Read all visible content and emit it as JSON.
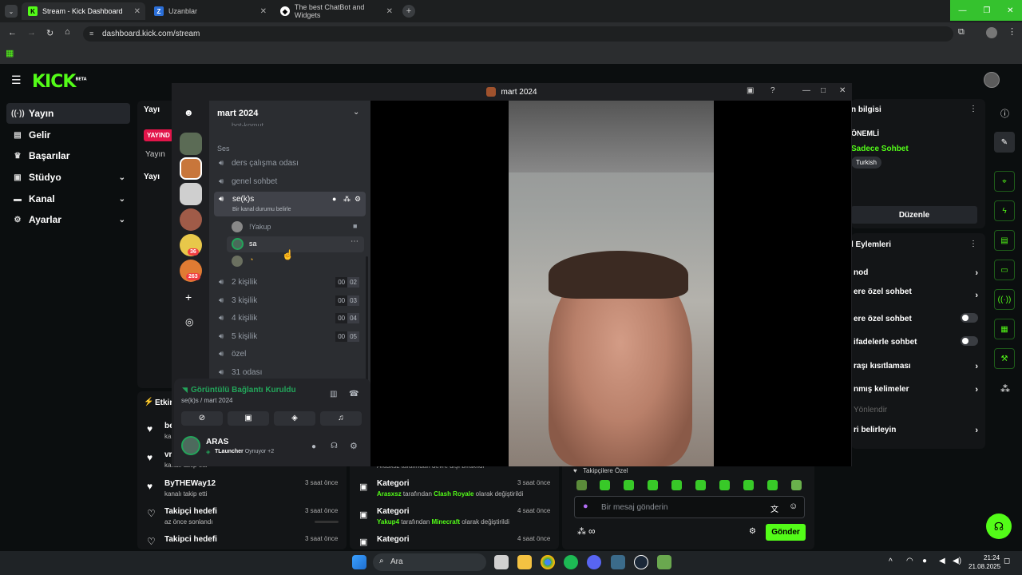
{
  "browser": {
    "tabs": [
      {
        "label": "Stream - Kick Dashboard",
        "icon": "kick-icon"
      },
      {
        "label": "Uzanblar",
        "icon": "globe-icon"
      },
      {
        "label": "The best ChatBot and Widgets",
        "icon": "bot-icon"
      }
    ],
    "url": "dashboard.kick.com/stream"
  },
  "kick": {
    "logo": "KICK",
    "beta": "BETA",
    "nav": [
      {
        "label": "Yayın",
        "icon": "broadcast-icon"
      },
      {
        "label": "Gelir",
        "icon": "income-icon"
      },
      {
        "label": "Başarılar",
        "icon": "trophy-icon"
      },
      {
        "label": "Stüdyo",
        "icon": "studio-icon"
      },
      {
        "label": "Kanal",
        "icon": "channel-icon"
      },
      {
        "label": "Ayarlar",
        "icon": "settings-icon"
      }
    ],
    "stream_panel": {
      "title": "Yayı",
      "live_badge": "YAYIND",
      "sub": "Yayın",
      "title2": "Yayı"
    },
    "activity": {
      "title": "Etkin",
      "rows": [
        {
          "name": "be",
          "desc": "kan",
          "time": ""
        },
        {
          "name": "vr",
          "desc": "kanalı takip etti",
          "time": ""
        },
        {
          "name": "ByTHEWay12",
          "desc": "kanalı takip etti",
          "time": "3 saat önce"
        },
        {
          "name": "Takipçi hedefi",
          "desc": "az önce sonlandı",
          "time": "3 saat önce"
        },
        {
          "name": "Takipci hedefi",
          "desc": "",
          "time": "3 saat önce"
        }
      ]
    },
    "category_feed": {
      "partial": "Arasxsz tarafından devre dışı bırakıldı",
      "rows": [
        {
          "title": "Kategori",
          "user": "Arasxsz",
          "mid": " tarafından ",
          "game": "Clash Royale",
          "end": " olarak değiştirildi",
          "time": "3 saat önce"
        },
        {
          "title": "Kategori",
          "user": "Yakup4",
          "mid": " tarafından ",
          "game": "Minecraft",
          "end": " olarak değiştirildi",
          "time": "4 saat önce"
        },
        {
          "title": "Kategori",
          "user": "",
          "mid": "",
          "game": "",
          "end": "",
          "time": "4 saat önce"
        }
      ]
    },
    "chat": {
      "followers_only": "Takipçilere Özel",
      "placeholder": "Bir mesaj gönderin",
      "send": "Gönder"
    },
    "right": {
      "info_title": "n bilgisi",
      "important": "ÖNEMLİ",
      "chat_mode": "Sadece Sohbet",
      "lang": "Turkish",
      "edit": "Düzenle",
      "actions_title": "l Eylemleri",
      "rows": [
        {
          "label": "nod",
          "kind": "chevron"
        },
        {
          "label": "ere özel sohbet",
          "kind": "chevron"
        },
        {
          "label": "ere özel sohbet",
          "kind": "toggle"
        },
        {
          "label": "ifadelerle sohbet",
          "kind": "toggle"
        },
        {
          "label": "raşı kısıtlaması",
          "kind": "chevron"
        },
        {
          "label": "nmış kelimeler",
          "kind": "chevron"
        },
        {
          "label": "Yönlendir",
          "kind": "muted"
        },
        {
          "label": "ri belirleyin",
          "kind": "chevron"
        }
      ]
    }
  },
  "discord": {
    "window_title": "mart 2024",
    "server_name": "mart 2024",
    "cut_channel": "bot-komut",
    "section": "Ses",
    "channels": [
      {
        "name": "ders çalışma odası"
      },
      {
        "name": "genel sohbet"
      },
      {
        "name": "se(k)s",
        "status": "Bir kanal durumu belirle"
      }
    ],
    "members": [
      {
        "name": "!Yakup"
      },
      {
        "name": "sa"
      },
      {
        "name": ""
      }
    ],
    "voice_channels": [
      {
        "name": "2 kişilik",
        "a": "00",
        "b": "02"
      },
      {
        "name": "3 kişilik",
        "a": "00",
        "b": "03"
      },
      {
        "name": "4 kişilik",
        "a": "00",
        "b": "04"
      },
      {
        "name": "5 kişilik",
        "a": "00",
        "b": "05"
      },
      {
        "name": "özel"
      },
      {
        "name": "31 odası"
      }
    ],
    "badges": [
      "36",
      "263"
    ],
    "voice_status": "Görüntülü Bağlantı Kuruldu",
    "voice_location": "se(k)s / mart 2024",
    "user": {
      "name": "ARAS",
      "activity_game": "TLauncher",
      "activity_tail": " Oynuyor +2"
    }
  },
  "taskbar": {
    "search": "Ara",
    "time": "21:24",
    "date": "21.08.2025"
  }
}
